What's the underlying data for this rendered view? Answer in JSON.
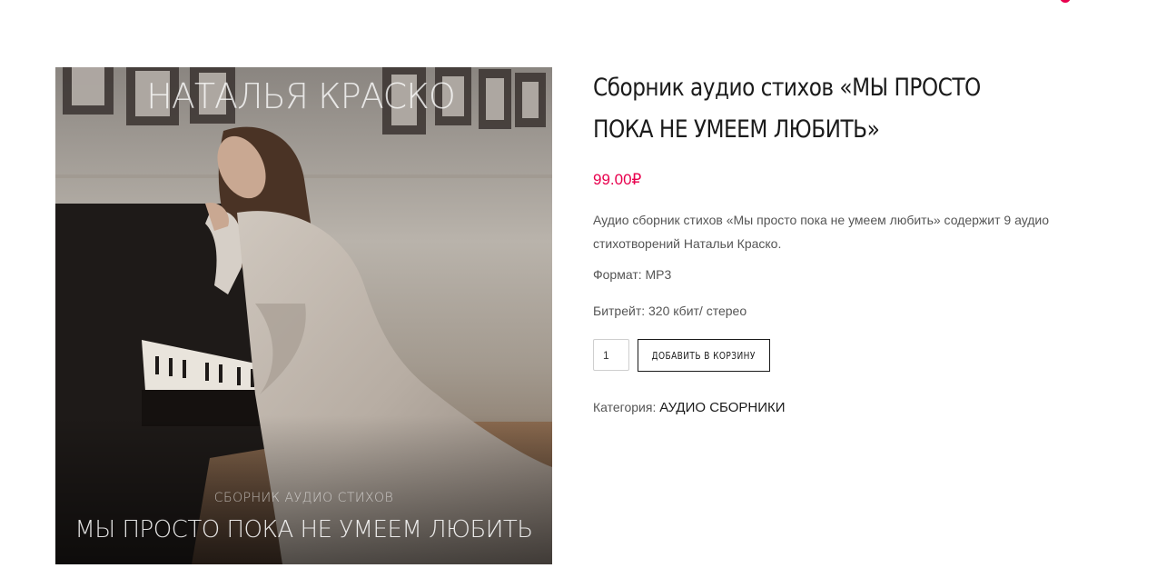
{
  "header": {
    "cart_indicator_color": "#e8004d"
  },
  "product": {
    "image": {
      "alt": "",
      "cover_author": "НАТАЛЬЯ КРАСКО",
      "cover_subtitle": "СБОРНИК АУДИО СТИХОВ",
      "cover_title": "МЫ ПРОСТО ПОКА НЕ УМЕЕМ ЛЮБИТЬ"
    },
    "title": "Сборник аудио стихов «МЫ ПРОСТО ПОКА НЕ УМЕЕМ ЛЮБИТЬ»",
    "price": "99.00₽",
    "price_color": "#e8004d",
    "description": "Аудио сборник стихов «Мы просто пока не умеем любить» содержит 9 аудио стихотворений Натальи Краско.",
    "format": "Формат: MP3",
    "bitrate": "Битрейт: 320 кбит/ стерео",
    "quantity": "1",
    "add_to_cart_label": "ДОБАВИТЬ В КОРЗИНУ",
    "category_label": "Категория:",
    "category_link": "АУДИО СБОРНИКИ"
  }
}
